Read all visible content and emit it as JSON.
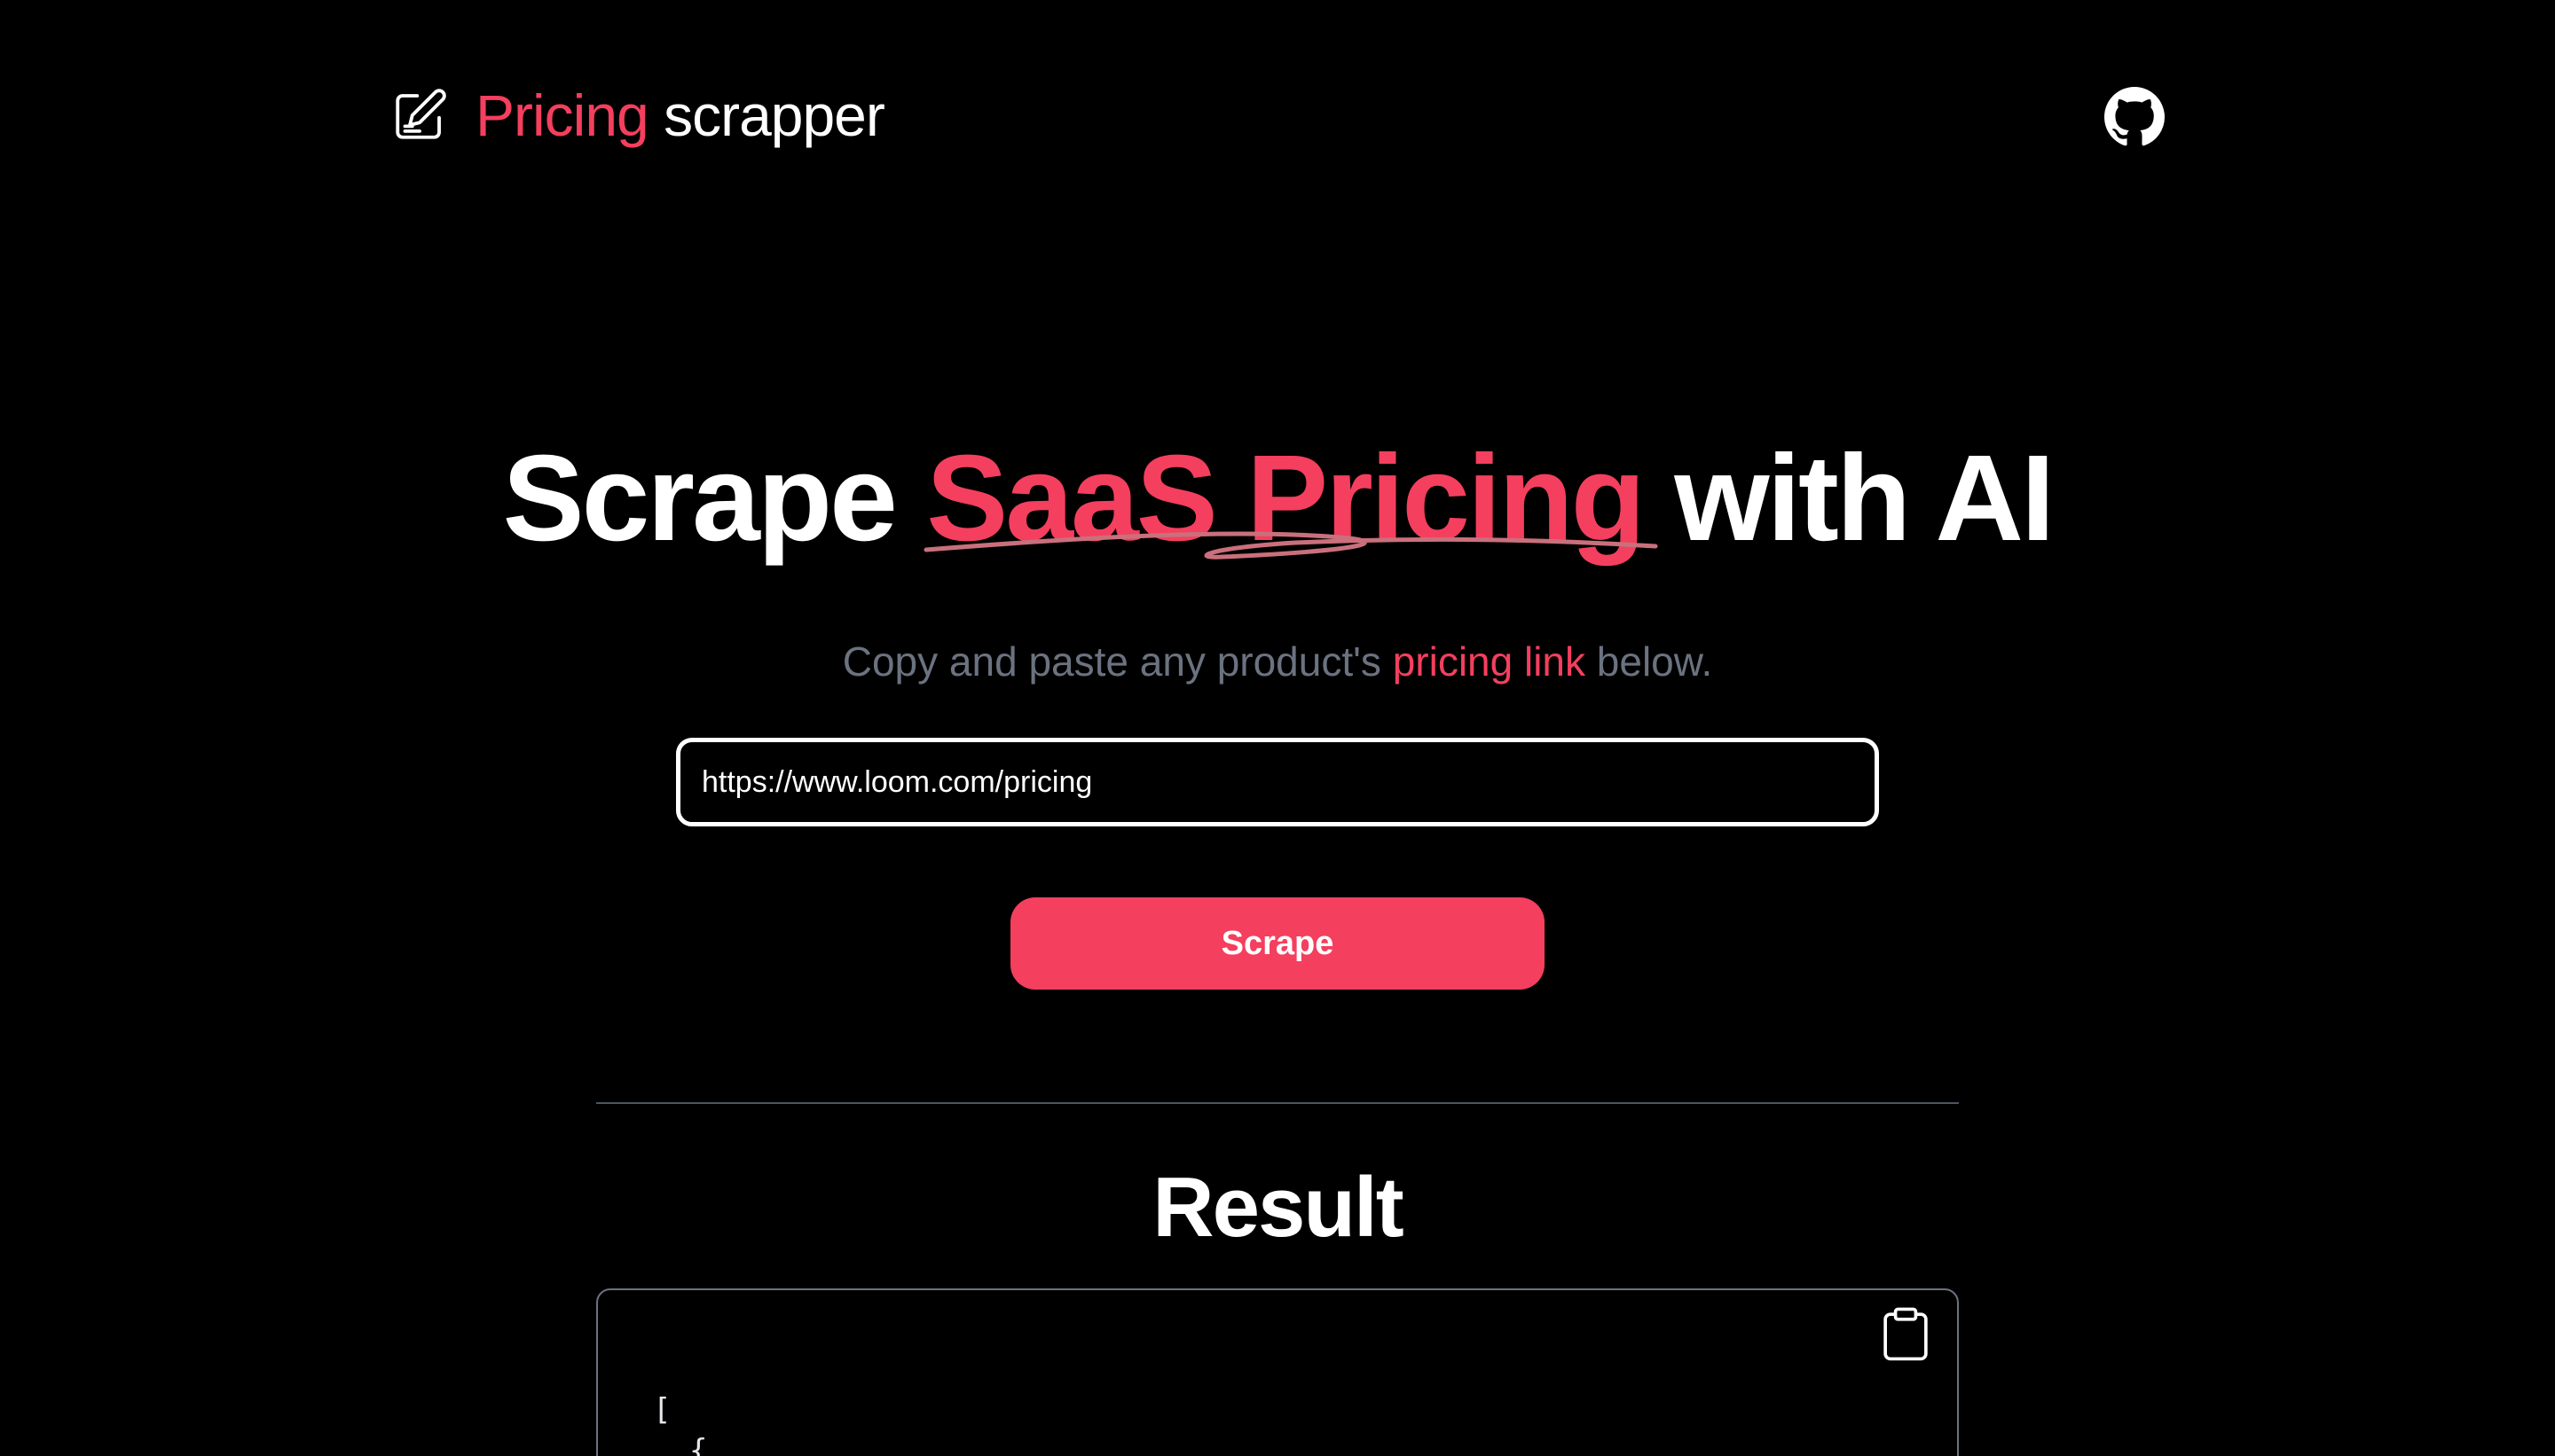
{
  "header": {
    "brand_accent": "Pricing",
    "brand_rest": " scrapper",
    "brand_icon": "edit-note-icon",
    "github_icon": "github-icon"
  },
  "hero": {
    "title_start": "Scrape ",
    "title_accent": "SaaS Pricing",
    "title_end": " with AI",
    "subtitle_start": "Copy and paste any product's ",
    "subtitle_accent": "pricing link",
    "subtitle_end": " below."
  },
  "form": {
    "url_value": "https://www.loom.com/pricing",
    "submit_label": "Scrape"
  },
  "result": {
    "title": "Result",
    "copy_icon": "clipboard-icon",
    "code_lines": [
      "[",
      "  {"
    ]
  },
  "colors": {
    "accent": "#f43f5e",
    "background": "#000000",
    "muted_text": "#6b7280",
    "divider": "#4b5563"
  }
}
